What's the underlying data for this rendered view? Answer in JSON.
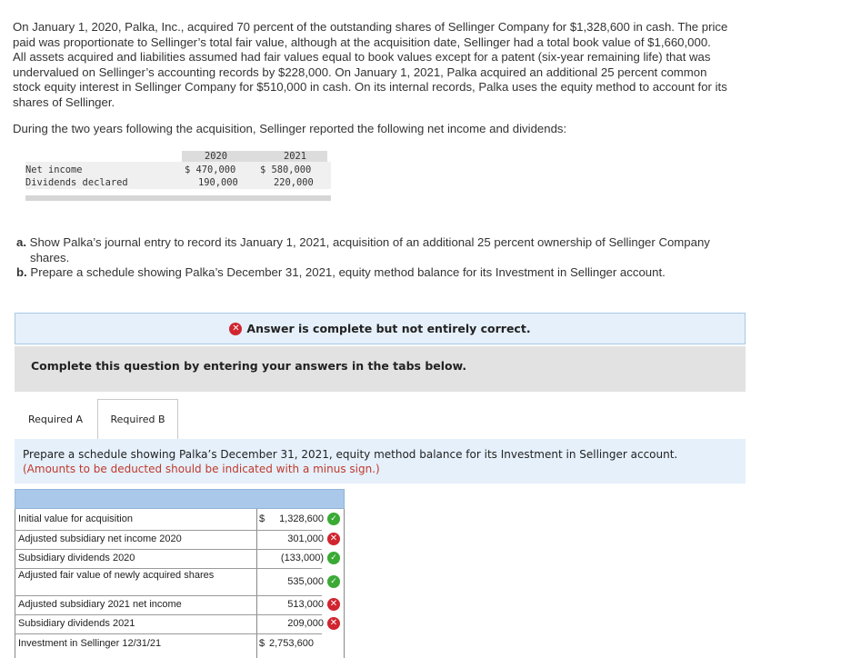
{
  "problem": {
    "lines": [
      "On January 1, 2020, Palka, Inc., acquired 70 percent of the outstanding shares of Sellinger Company for $1,328,600 in cash. The price",
      "paid was proportionate to Sellinger’s total fair value, although at the acquisition date, Sellinger had a total book value of $1,660,000.",
      "All assets acquired and liabilities assumed had fair values equal to book values except for a patent (six-year remaining life) that was",
      "undervalued on Sellinger’s accounting records by $228,000. On January 1, 2021, Palka acquired an additional 25 percent common",
      "stock equity interest in Sellinger Company for $510,000 in cash. On its internal records, Palka uses the equity method to account for its",
      "shares of Sellinger."
    ],
    "paragraph2": "During the two years following the acquisition, Sellinger reported the following net income and dividends:"
  },
  "income_table": {
    "col_2020": "2020",
    "col_2021": "2021",
    "row1_label": "Net income",
    "row1_2020": "$ 470,000",
    "row1_2021": "$ 580,000",
    "row2_label": "Dividends declared",
    "row2_2020": "190,000",
    "row2_2021": "220,000"
  },
  "questions": {
    "a_label": "a.",
    "a_line1": "Show Palka’s journal entry to record its January 1, 2021, acquisition of an additional 25 percent ownership of Sellinger Company",
    "a_line2": "shares.",
    "b_label": "b.",
    "b_text": "Prepare a schedule showing Palka’s December 31, 2021, equity method balance for its Investment in Sellinger account."
  },
  "banner": {
    "text": "Answer is complete but not entirely correct."
  },
  "complete": {
    "text": "Complete this question by entering your answers in the tabs below."
  },
  "tabs": [
    {
      "label": "Required A"
    },
    {
      "label": "Required B"
    }
  ],
  "instructions": {
    "line1": "Prepare a schedule showing Palka’s December 31, 2021, equity method balance for its Investment in Sellinger account.",
    "line2": "(Amounts to be deducted should be indicated with a minus sign.)"
  },
  "schedule": {
    "rows": [
      {
        "label": "Initial value for acquisition",
        "dollar": "$",
        "value": "1,328,600",
        "status": "correct"
      },
      {
        "label": "Adjusted subsidiary net income 2020",
        "dollar": "",
        "value": "301,000",
        "status": "incorrect"
      },
      {
        "label": "Subsidiary dividends 2020",
        "dollar": "",
        "value": "(133,000)",
        "status": "correct"
      },
      {
        "label": "Adjusted fair value of newly acquired shares",
        "dollar": "",
        "value": "535,000",
        "status": "correct"
      },
      {
        "label": "Adjusted subsidiary 2021 net income",
        "dollar": "",
        "value": "513,000",
        "status": "incorrect"
      },
      {
        "label": "Subsidiary dividends 2021",
        "dollar": "",
        "value": "209,000",
        "status": "incorrect"
      },
      {
        "label": "Investment in Sellinger 12/31/21",
        "dollar": "$",
        "value": "2,753,600",
        "status": "none"
      }
    ]
  },
  "colors": {
    "correct": "#3aaa35",
    "incorrect": "#d0252f",
    "header": "#a9c8ea",
    "banner": "#e5f0fb"
  },
  "icons": {
    "correct": "check-circle-icon",
    "incorrect": "x-circle-icon"
  }
}
